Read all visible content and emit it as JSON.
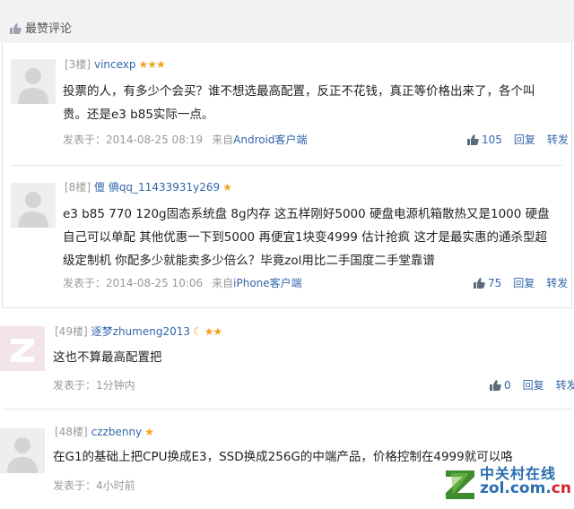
{
  "section": {
    "title": "最赞评论"
  },
  "comments": [
    {
      "floor": "[3楼]",
      "user": "vincexp",
      "rank": "★★★",
      "text_lines": [
        "投票的人，有多少个会买？谁不想选最高配置，反正不花钱，真正等价格出来了，各个叫",
        "贵。还是e3 b85实际一点。"
      ],
      "posted": "发表于：2014-08-25 08:19",
      "source_prefix": "来自",
      "source_client": "Android客户端",
      "likes": "105",
      "reply": "回复",
      "forward": "转发"
    },
    {
      "floor": "[8楼]",
      "user": "儃 倎qq_11433931y269",
      "rank": "★",
      "text_lines": [
        "e3 b85 770 120g固态系统盘 8g内存 这五样刚好5000 硬盘电源机箱散热又是1000 硬盘",
        "自己可以单配 其他优惠一下到5000 再便宜1块变4999 估计抢疯 这才是最实惠的通杀型超",
        "级定制机 你配多少就能卖多少倍么？毕竟zol用比二手国度二手堂靠谱"
      ],
      "posted": "发表于：2014-08-25 10:06",
      "source_prefix": "来自",
      "source_client": "iPhone客户端",
      "likes": "75",
      "reply": "回复",
      "forward": "转发"
    },
    {
      "floor": "[49楼]",
      "user": "逐梦zhumeng2013",
      "rank_moon": "☾",
      "rank": "★★",
      "text_lines": [
        "这也不算最高配置把"
      ],
      "posted": "发表于：1分钟内",
      "likes": "0",
      "reply": "回复",
      "forward": "转发"
    },
    {
      "floor": "[48楼]",
      "user": "czzbenny",
      "rank": "★",
      "text_lines": [
        "在G1的基础上把CPU换成E3，SSD换成256G的中端产品，价格控制在4999就可以咯"
      ],
      "posted": "发表于：4小时前"
    }
  ],
  "watermark": {
    "cn": "中关村在线",
    "en_a": "zol.com.",
    "en_b": "cn"
  },
  "colors": {
    "link": "#3366aa",
    "star": "#f4a21e",
    "muted": "#999999",
    "header_bg": "#f2f2f2"
  }
}
